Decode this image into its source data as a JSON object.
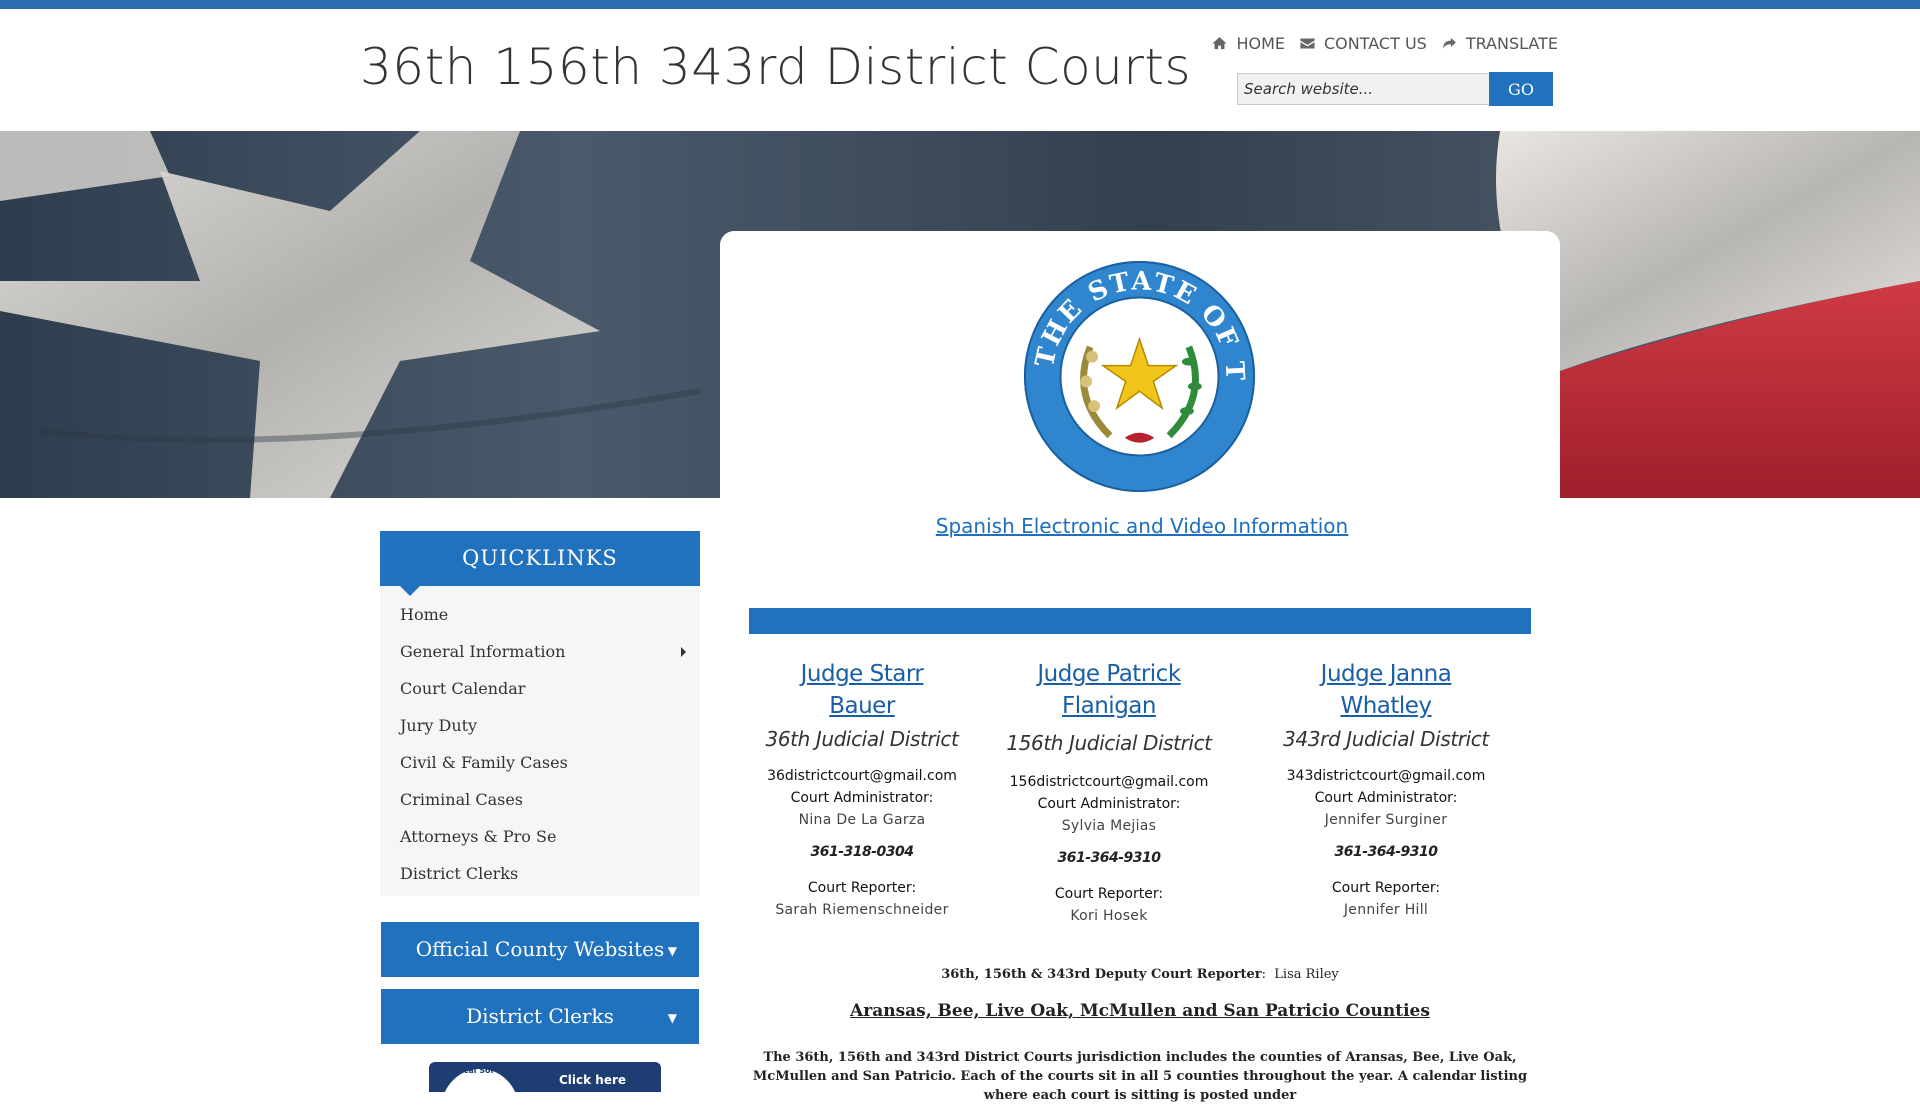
{
  "header": {
    "site_title": "36th 156th 343rd District Courts",
    "nav": [
      {
        "label": "HOME",
        "icon": "home-icon"
      },
      {
        "label": "CONTACT US",
        "icon": "envelope-icon"
      },
      {
        "label": "TRANSLATE",
        "icon": "share-icon"
      }
    ],
    "search_placeholder": "Search website...",
    "search_button": "GO"
  },
  "seal": {
    "text": "THE STATE OF TEXAS"
  },
  "main": {
    "spanish_link": "Spanish Electronic and Video Information",
    "judges": [
      {
        "name": "Judge Starr Bauer",
        "name_line1": "Judge Starr",
        "name_line2": "Bauer",
        "district": "36th Judicial District",
        "email": "36districtcourt@gmail.com",
        "admin_label": "Court Administrator:",
        "admin": "Nina De La Garza",
        "phone": "361-318-0304",
        "reporter_label": "Court Reporter:",
        "reporter": "Sarah Riemenschneider"
      },
      {
        "name": "Judge Patrick Flanigan",
        "name_line1": "Judge Patrick",
        "name_line2": "Flanigan",
        "district": "156th Judicial District",
        "email": "156districtcourt@gmail.com",
        "admin_label": "Court Administrator:",
        "admin": "Sylvia Mejias",
        "phone": "361-364-9310",
        "reporter_label": "Court Reporter:",
        "reporter": "Kori Hosek"
      },
      {
        "name": "Judge Janna Whatley",
        "name_line1": "Judge Janna",
        "name_line2": "Whatley",
        "district": "343rd Judicial District",
        "email": "343districtcourt@gmail.com",
        "admin_label": "Court Administrator:",
        "admin": "Jennifer Surginer",
        "phone": "361-364-9310",
        "reporter_label": "Court Reporter:",
        "reporter": "Jennifer Hill"
      }
    ],
    "deputy_label": "36th, 156th & 343rd Deputy Court Reporter",
    "deputy_name": "Lisa Riley",
    "counties_heading": "Aransas, Bee, Live Oak, McMullen and San Patricio Counties",
    "jurisdiction_text": "The 36th, 156th and 343rd District Courts jurisdiction includes the counties of Aransas, Bee, Live Oak, McMullen and San Patricio.  Each of the courts sit in all 5 counties throughout the year.  A calendar listing where each court is sitting is posted under"
  },
  "sidebar": {
    "quicklinks_title": "QUICKLINKS",
    "items": [
      {
        "label": "Home",
        "has_submenu": false
      },
      {
        "label": "General Information",
        "has_submenu": true
      },
      {
        "label": "Court Calendar",
        "has_submenu": false
      },
      {
        "label": "Jury Duty",
        "has_submenu": false
      },
      {
        "label": "Civil & Family Cases",
        "has_submenu": false
      },
      {
        "label": "Criminal Cases",
        "has_submenu": false
      },
      {
        "label": "Attorneys & Pro Se",
        "has_submenu": false
      },
      {
        "label": "District Clerks",
        "has_submenu": false
      }
    ],
    "dropdowns": [
      {
        "label": "Official County Websites",
        "arrow": "▼"
      },
      {
        "label": "District Clerks",
        "arrow": "▼"
      }
    ],
    "badge_text": "Click here",
    "badge_circle_text": "Local Sol"
  },
  "colors": {
    "accent": "#2172be",
    "link": "#1f6fbe",
    "topbar": "#2b6cb0",
    "seal_blue": "#2f86cf"
  }
}
